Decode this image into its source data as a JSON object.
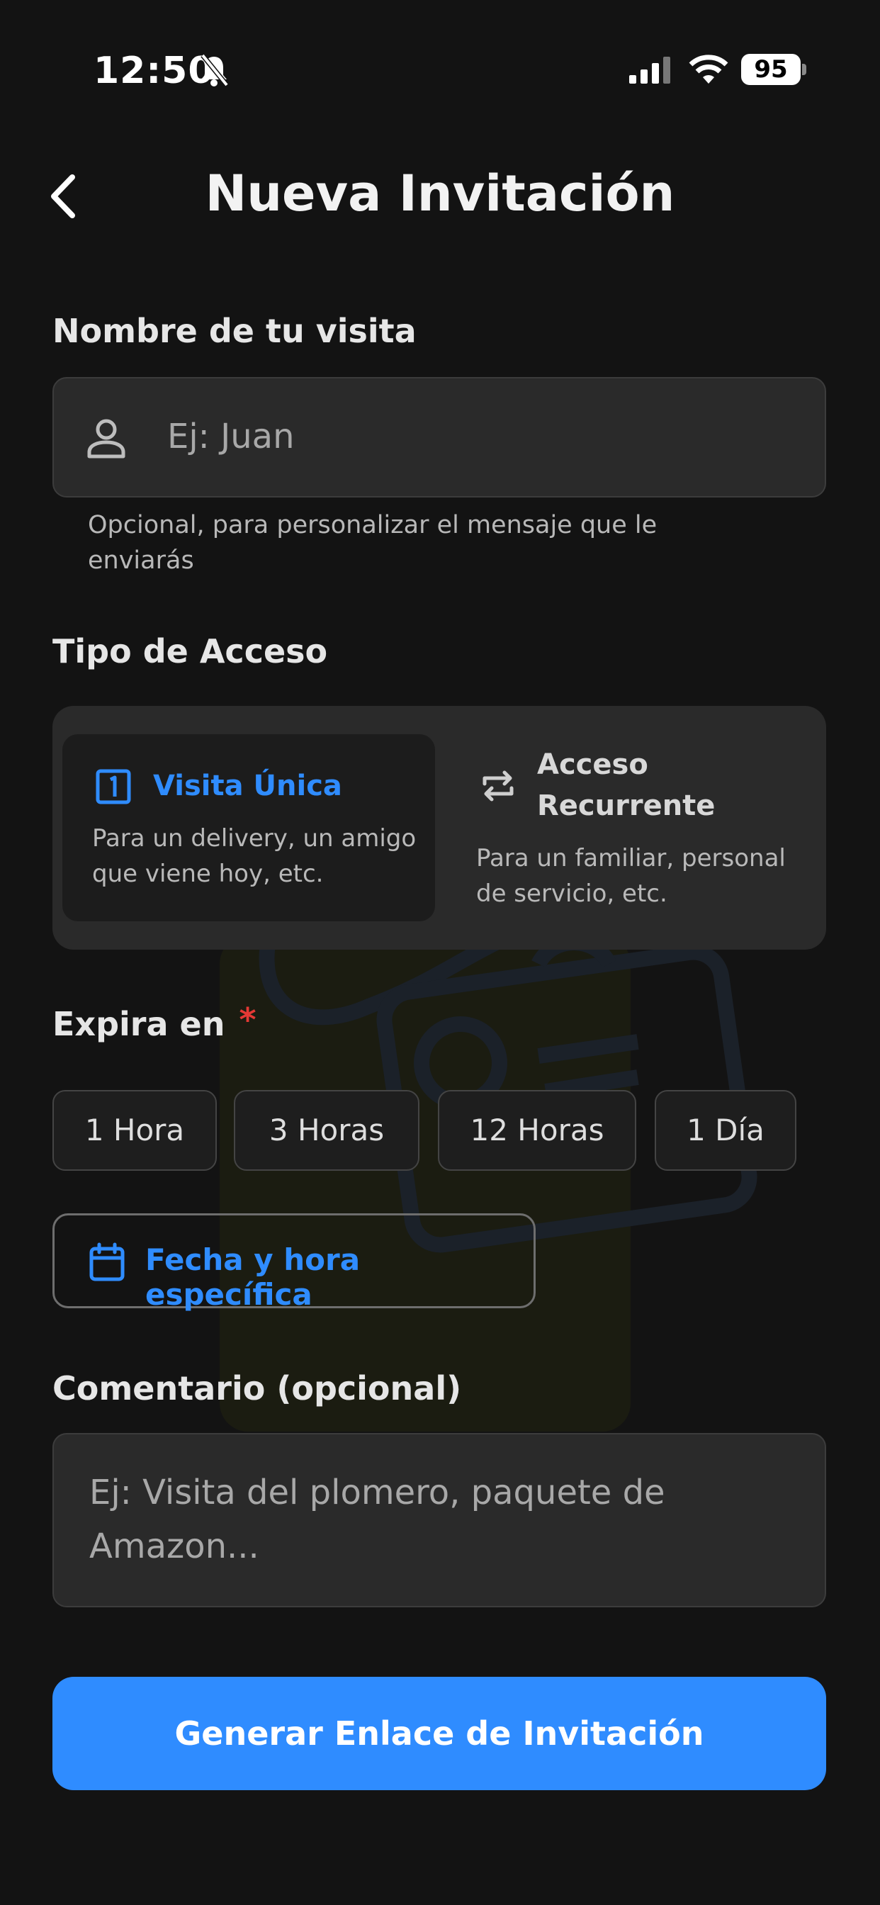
{
  "status_bar": {
    "time": "12:50",
    "battery": "95"
  },
  "header": {
    "title": "Nueva Invitación"
  },
  "visitor": {
    "label": "Nombre de tu visita",
    "placeholder": "Ej: Juan",
    "helper": "Opcional, para personalizar el mensaje que le enviarás"
  },
  "access": {
    "label": "Tipo de Acceso",
    "options": [
      {
        "title": "Visita Única",
        "description": "Para un delivery, un amigo que viene hoy, etc.",
        "selected": true
      },
      {
        "title": "Acceso Recurrente",
        "description": "Para un familiar, personal de servicio, etc.",
        "selected": false
      }
    ]
  },
  "expiry": {
    "label": "Expira en",
    "required_mark": "*",
    "chips": [
      "1 Hora",
      "3 Horas",
      "12 Horas",
      "1 Día"
    ],
    "custom_label": "Fecha y hora específica"
  },
  "comment": {
    "label": "Comentario (opcional)",
    "placeholder": "Ej: Visita del plomero, paquete de Amazon..."
  },
  "submit_label": "Generar Enlace de Invitación",
  "colors": {
    "accent": "#2f8cff",
    "background": "#131313",
    "required": "#e53935"
  }
}
